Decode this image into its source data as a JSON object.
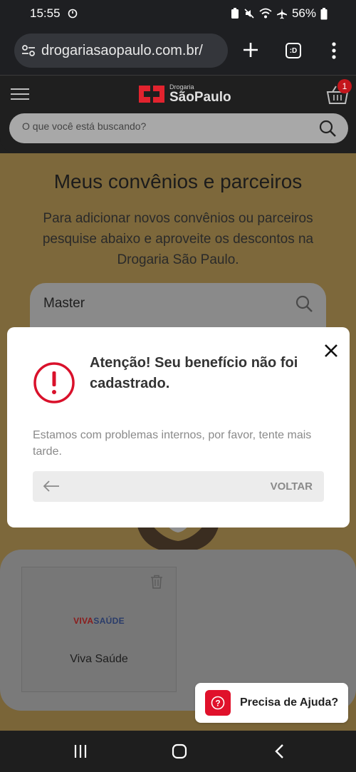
{
  "status_bar": {
    "time": "15:55",
    "battery": "56%"
  },
  "browser": {
    "url": "drogariasaopaulo.com.br/",
    "tabs_label": ":D"
  },
  "site_header": {
    "logo_small": "Drogaria",
    "logo_big": "SãoPaulo",
    "cart_count": "1",
    "search_placeholder": "O que você está buscando?"
  },
  "main": {
    "title": "Meus convênios e parceiros",
    "description": "Para adicionar novos convênios ou parceiros pesquise abaixo e aproveite os descontos na Drogaria São Paulo.",
    "search_value": "Master",
    "partners": [
      {
        "logo_part1": "VIVA",
        "logo_part2": "SAÚDE",
        "name": "Viva Saúde"
      }
    ]
  },
  "modal": {
    "title": "Atenção! Seu benefício não foi cadastrado.",
    "message": "Estamos com problemas internos, por favor, tente mais tarde.",
    "back_label": "VOLTAR"
  },
  "help": {
    "label": "Precisa de Ajuda?"
  },
  "colors": {
    "brand_red": "#e2232e",
    "help_red": "#e0112b",
    "alert_red": "#d9112b"
  }
}
